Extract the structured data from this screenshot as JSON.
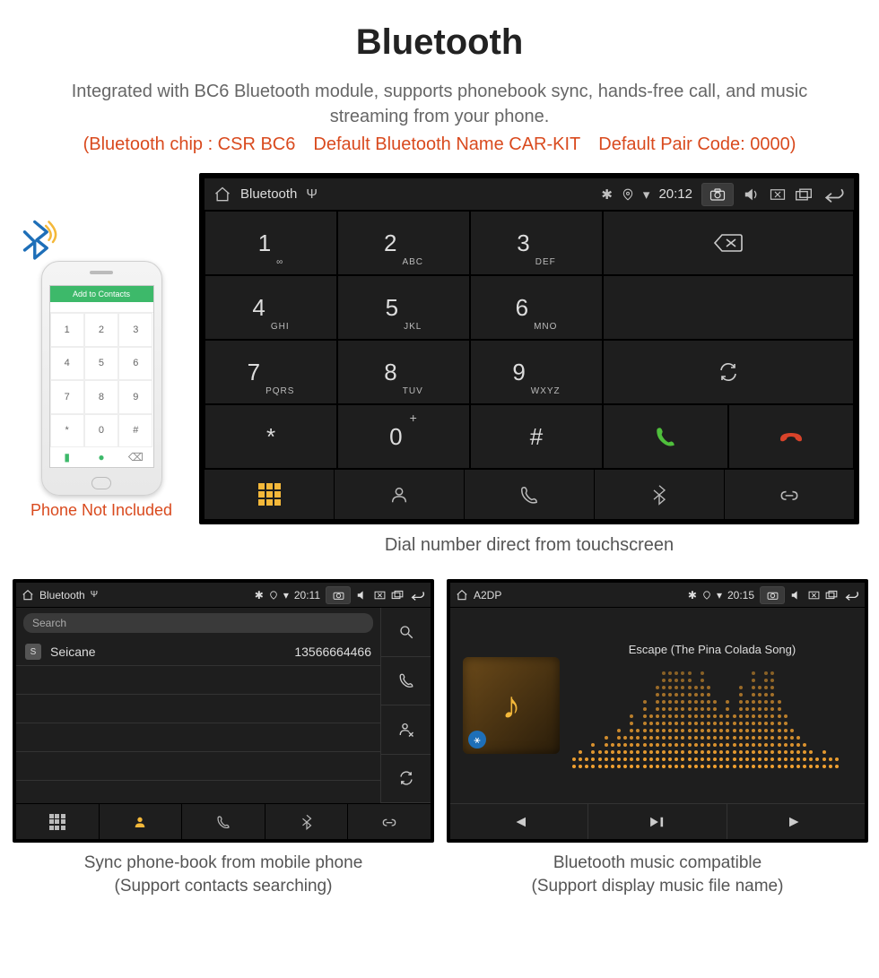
{
  "header": {
    "title": "Bluetooth",
    "description": "Integrated with BC6 Bluetooth module, supports phonebook sync, hands-free call, and music streaming from your phone.",
    "specs": "(Bluetooth chip : CSR BC6 Default Bluetooth Name CAR-KIT Default Pair Code: 0000)"
  },
  "phone_mock": {
    "header_text": "Add to Contacts",
    "keys": [
      "1",
      "2",
      "3",
      "4",
      "5",
      "6",
      "7",
      "8",
      "9",
      "*",
      "0",
      "#"
    ],
    "caption": "Phone Not Included"
  },
  "dialer": {
    "statusbar": {
      "title": "Bluetooth",
      "time": "20:12"
    },
    "keys": [
      {
        "num": "1",
        "sub": "∞"
      },
      {
        "num": "2",
        "sub": "ABC"
      },
      {
        "num": "3",
        "sub": "DEF"
      },
      {
        "num": "4",
        "sub": "GHI"
      },
      {
        "num": "5",
        "sub": "JKL"
      },
      {
        "num": "6",
        "sub": "MNO"
      },
      {
        "num": "7",
        "sub": "PQRS"
      },
      {
        "num": "8",
        "sub": "TUV"
      },
      {
        "num": "9",
        "sub": "WXYZ"
      },
      {
        "num": "*",
        "sub": ""
      },
      {
        "num": "0",
        "sub": "+",
        "supersub": true
      },
      {
        "num": "#",
        "sub": ""
      }
    ],
    "caption": "Dial number direct from touchscreen"
  },
  "contacts": {
    "statusbar": {
      "title": "Bluetooth",
      "time": "20:11"
    },
    "search_placeholder": "Search",
    "rows": [
      {
        "tag": "S",
        "name": "Seicane",
        "number": "13566664466"
      }
    ],
    "caption_line1": "Sync phone-book from mobile phone",
    "caption_line2": "(Support contacts searching)"
  },
  "player": {
    "statusbar": {
      "title": "A2DP",
      "time": "20:15"
    },
    "track": "Escape (The Pina Colada Song)",
    "caption_line1": "Bluetooth music compatible",
    "caption_line2": "(Support display music file name)"
  }
}
